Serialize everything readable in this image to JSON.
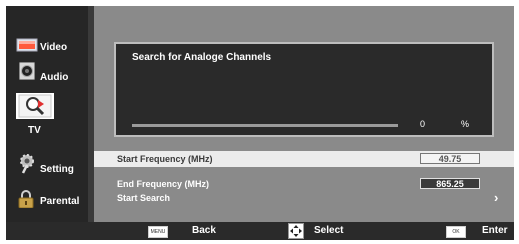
{
  "sidebar": {
    "items": [
      {
        "label": "Video",
        "icon": "video-icon"
      },
      {
        "label": "Audio",
        "icon": "audio-icon"
      },
      {
        "label": "TV",
        "icon": "tv-search-icon"
      },
      {
        "label": "Setting",
        "icon": "setting-icon"
      },
      {
        "label": "Parental",
        "icon": "parental-lock-icon"
      }
    ],
    "selected": "TV"
  },
  "dialog": {
    "title": "Search for Analoge Channels",
    "progress_value": "0",
    "progress_unit": "%",
    "progress_fraction": 0
  },
  "rows": [
    {
      "label": "Start Frequency (MHz)",
      "value": "49.75"
    },
    {
      "label": "End Frequency (MHz)",
      "value": "865.25"
    },
    {
      "label": "Start Search",
      "chevron": "›"
    }
  ],
  "bottom_bar": {
    "back": {
      "key": "MENU",
      "label": "Back"
    },
    "select": {
      "label": "Select",
      "icon": "dpad-icon"
    },
    "enter": {
      "key": "OK",
      "label": "Enter"
    }
  },
  "colors": {
    "background": "#3a3a3a",
    "sidebar": "#262626",
    "content": "#8a8a8a",
    "selected_row": "#ececec",
    "sidebar_selected": "#ffffff"
  }
}
